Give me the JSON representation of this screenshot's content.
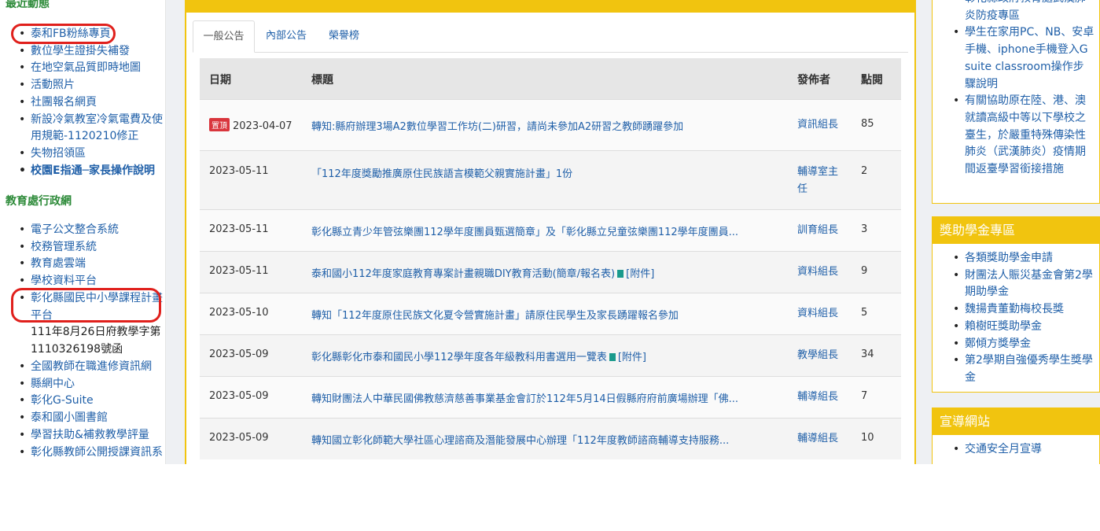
{
  "left": {
    "section1_title": "最近動態",
    "section1_items": [
      {
        "label": "泰和FB粉絲專頁",
        "strong": false
      },
      {
        "label": "數位學生證掛失補發",
        "strong": false
      },
      {
        "label": "在地空氣品質即時地圖",
        "strong": false
      },
      {
        "label": "活動照片",
        "strong": false
      },
      {
        "label": "社團報名網頁",
        "strong": false
      },
      {
        "label": "新設冷氣教室冷氣電費及使用規範-1120210修正",
        "strong": false
      },
      {
        "label": "失物招領區",
        "strong": false
      },
      {
        "label": "校園E指通─家長操作說明",
        "strong": true
      }
    ],
    "section2_title": "教育處行政網",
    "section2_items_a": [
      "電子公文整合系統",
      "校務管理系統",
      "教育處雲端",
      "學校資料平台",
      "彰化縣國民中小學課程計畫平台"
    ],
    "section2_note": "111年8月26日府教學字第1110326198號函",
    "section2_items_b": [
      "全國教師在職進修資訊網",
      "縣網中心",
      "彰化G-Suite",
      "泰和國小圖書館",
      "學習扶助&補救教學評量",
      "彰化縣教師公開授課資訊系"
    ]
  },
  "tabs": [
    "一般公告",
    "內部公告",
    "榮譽榜"
  ],
  "table": {
    "headers": {
      "date": "日期",
      "title": "標題",
      "publisher": "發佈者",
      "hits": "點閱"
    },
    "pin_label": "置頂",
    "attachment_label": "[附件]",
    "rows": [
      {
        "pinned": true,
        "date": "2023-04-07",
        "title": "轉知:縣府辦理3場A2數位學習工作坊(二)研習，請尚未參加A2研習之教師踴躍參加",
        "attach": false,
        "publisher": "資訊組長",
        "hits": "85"
      },
      {
        "pinned": false,
        "date": "2023-05-11",
        "title": "「112年度獎勵推廣原住民族語言模範父親實施計畫」1份",
        "attach": false,
        "publisher": "輔導室主任",
        "hits": "2"
      },
      {
        "pinned": false,
        "date": "2023-05-11",
        "title": "彰化縣立青少年管弦樂團112學年度團員甄選簡章」及「彰化縣立兒童弦樂團112學年度團員...",
        "attach": false,
        "publisher": "訓育組長",
        "hits": "3"
      },
      {
        "pinned": false,
        "date": "2023-05-11",
        "title": "泰和國小112年度家庭教育專案計畫親職DIY教育活動(簡章/報名表)",
        "attach": true,
        "publisher": "資料組長",
        "hits": "9"
      },
      {
        "pinned": false,
        "date": "2023-05-10",
        "title": "轉知「112年度原住民族文化夏令營實施計畫」請原住民學生及家長踴躍報名參加",
        "attach": false,
        "publisher": "資料組長",
        "hits": "5"
      },
      {
        "pinned": false,
        "date": "2023-05-09",
        "title": "彰化縣彰化市泰和國民小學112學年度各年級教科用書選用一覽表",
        "attach": true,
        "publisher": "教學組長",
        "hits": "34"
      },
      {
        "pinned": false,
        "date": "2023-05-09",
        "title": "轉知財團法人中華民國佛教慈濟慈善事業基金會訂於112年5月14日假縣府府前廣場辦理「佛...",
        "attach": false,
        "publisher": "輔導組長",
        "hits": "7"
      },
      {
        "pinned": false,
        "date": "2023-05-09",
        "title": "轉知國立彰化師範大學社區心理諮商及潛能發展中心辦理「112年度教師諮商輔導支持服務...",
        "attach": false,
        "publisher": "輔導組長",
        "hits": "10"
      }
    ]
  },
  "right": {
    "box1_items": [
      "彰化縣政府教育處武漢肺炎防疫專區",
      "學生在家用PC、NB、安卓手機、iphone手機登入G suite classroom操作步驟說明",
      "有關協助原在陸、港、澳就讀高級中等以下學校之臺生，於嚴重特殊傳染性肺炎（武漢肺炎）疫情期間返臺學習銜接措施"
    ],
    "box2_title": "獎助學金專區",
    "box2_items": [
      "各類獎助學金申請",
      "財團法人賑災基金會第2學期助學金",
      "魏揚貴董勤梅校長獎",
      "賴樹旺獎助學金",
      "鄭傾方獎學金",
      "第2學期自強優秀學生獎學金"
    ],
    "box3_title": "宣導網站",
    "box3_items": [
      "交通安全月宣導"
    ]
  },
  "colors": {
    "accent": "#f1c40f",
    "link": "#1f5fa8",
    "section_title": "#2e8b3a",
    "highlight": "#e0201c"
  }
}
